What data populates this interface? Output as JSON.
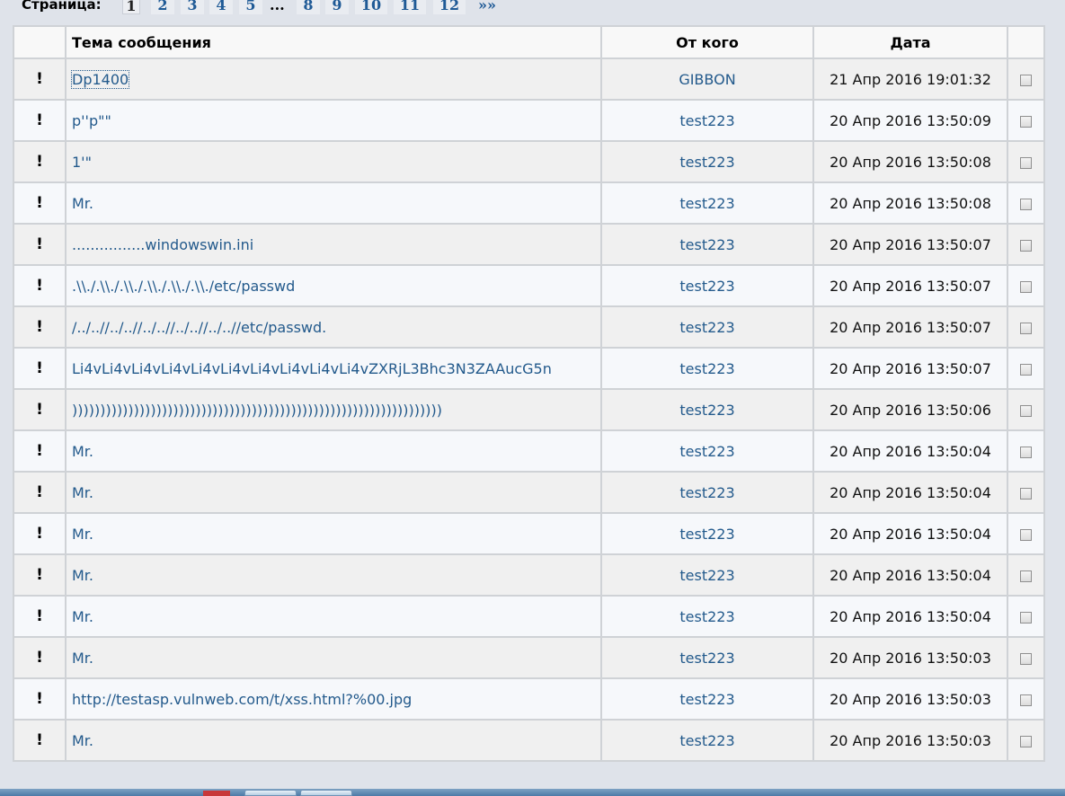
{
  "pagination": {
    "label": "Страница:",
    "pages": [
      "1",
      "2",
      "3",
      "4",
      "5",
      "8",
      "9",
      "10",
      "11",
      "12"
    ],
    "current": "1",
    "ellipsis": "...",
    "next": "»»"
  },
  "table": {
    "headers": {
      "flag": "",
      "subject": "Тема сообщения",
      "from": "От кого",
      "date": "Дата",
      "select": ""
    },
    "rows": [
      {
        "flag": "!",
        "subject": "Dp1400",
        "from": "GIBBON",
        "date": "21 Апр 2016 19:01:32"
      },
      {
        "flag": "!",
        "subject": "p''p\"\"",
        "from": "test223",
        "date": "20 Апр 2016 13:50:09"
      },
      {
        "flag": "!",
        "subject": "1'\"",
        "from": "test223",
        "date": "20 Апр 2016 13:50:08"
      },
      {
        "flag": "!",
        "subject": "Mr.",
        "from": "test223",
        "date": "20 Апр 2016 13:50:08"
      },
      {
        "flag": "!",
        "subject": "................windowswin.ini",
        "from": "test223",
        "date": "20 Апр 2016 13:50:07"
      },
      {
        "flag": "!",
        "subject": ".\\\\./.\\\\./.\\\\./.\\\\./.\\\\./.\\\\./etc/passwd",
        "from": "test223",
        "date": "20 Апр 2016 13:50:07"
      },
      {
        "flag": "!",
        "subject": "/../..//../..//../..//../..//../..//etc/passwd.",
        "from": "test223",
        "date": "20 Апр 2016 13:50:07"
      },
      {
        "flag": "!",
        "subject": "Li4vLi4vLi4vLi4vLi4vLi4vLi4vLi4vLi4vLi4vZXRjL3Bhc3N3ZAAucG5n",
        "from": "test223",
        "date": "20 Апр 2016 13:50:07"
      },
      {
        "flag": "!",
        "subject": "))))))))))))))))))))))))))))))))))))))))))))))))))))))))))))))))))",
        "from": "test223",
        "date": "20 Апр 2016 13:50:06"
      },
      {
        "flag": "!",
        "subject": "Mr.",
        "from": "test223",
        "date": "20 Апр 2016 13:50:04"
      },
      {
        "flag": "!",
        "subject": "Mr.",
        "from": "test223",
        "date": "20 Апр 2016 13:50:04"
      },
      {
        "flag": "!",
        "subject": "Mr.",
        "from": "test223",
        "date": "20 Апр 2016 13:50:04"
      },
      {
        "flag": "!",
        "subject": "Mr.",
        "from": "test223",
        "date": "20 Апр 2016 13:50:04"
      },
      {
        "flag": "!",
        "subject": "Mr.",
        "from": "test223",
        "date": "20 Апр 2016 13:50:04"
      },
      {
        "flag": "!",
        "subject": "Mr.",
        "from": "test223",
        "date": "20 Апр 2016 13:50:03"
      },
      {
        "flag": "!",
        "subject": "http://testasp.vulnweb.com/t/xss.html?%00.jpg",
        "from": "test223",
        "date": "20 Апр 2016 13:50:03"
      },
      {
        "flag": "!",
        "subject": "Mr.",
        "from": "test223",
        "date": "20 Апр 2016 13:50:03"
      }
    ]
  }
}
